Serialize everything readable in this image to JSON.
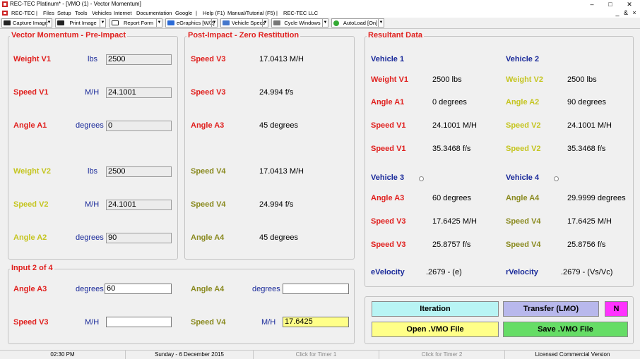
{
  "window": {
    "title": "REC-TEC Platinum* - [VMO (1) - Vector Momentum]",
    "minimize": "–",
    "maximize": "□",
    "close": "✕",
    "child_minimize": "_",
    "child_restore": "&",
    "child_close": "×"
  },
  "menu": {
    "app": "REC-TEC",
    "items": [
      "Files",
      "Setup",
      "Tools",
      "Vehicles",
      "Internet",
      "Documentation",
      "Google"
    ],
    "help": "Help (F1)",
    "manual": "Manual/Tutorial (F5)",
    "company": "REC-TEC LLC"
  },
  "toolbar": {
    "capture": "Capture Image",
    "print": "Print Image",
    "report": "Report Form",
    "egraphics": "eGraphics [W/2]",
    "vehicle_specs": "Vehicle Specs",
    "cycle": "Cycle Windows",
    "autoload": "AutoLoad [On]"
  },
  "pre": {
    "title": "Vector Momentum - Pre-Impact",
    "weight_v1": {
      "label": "Weight V1",
      "unit": "lbs",
      "value": "2500"
    },
    "speed_v1": {
      "label": "Speed V1",
      "unit": "M/H",
      "value": "24.1001"
    },
    "angle_a1": {
      "label": "Angle A1",
      "unit": "degrees",
      "value": "0"
    },
    "weight_v2": {
      "label": "Weight V2",
      "unit": "lbs",
      "value": "2500"
    },
    "speed_v2": {
      "label": "Speed V2",
      "unit": "M/H",
      "value": "24.1001"
    },
    "angle_a2": {
      "label": "Angle A2",
      "unit": "degrees",
      "value": "90"
    }
  },
  "post": {
    "title": "Post-Impact - Zero Restitution",
    "r1": {
      "label": "Speed V3",
      "value": "17.0413  M/H"
    },
    "r2": {
      "label": "Speed V3",
      "value": "24.994  f/s"
    },
    "r3": {
      "label": "Angle A3",
      "value": "45  degrees"
    },
    "r4": {
      "label": "Speed V4",
      "value": "17.0413  M/H"
    },
    "r5": {
      "label": "Speed V4",
      "value": "24.994  f/s"
    },
    "r6": {
      "label": "Angle A4",
      "value": "45  degrees"
    }
  },
  "input": {
    "title": "Input 2 of 4",
    "angle_a3": {
      "label": "Angle A3",
      "unit": "degrees",
      "value": "60"
    },
    "angle_a4": {
      "label": "Angle A4",
      "unit": "degrees",
      "value": ""
    },
    "speed_v3": {
      "label": "Speed V3",
      "unit": "M/H",
      "value": ""
    },
    "speed_v4": {
      "label": "Speed V4",
      "unit": "M/H",
      "value": "17.6425"
    }
  },
  "result": {
    "title": "Resultant Data",
    "vehicle1": "Vehicle 1",
    "vehicle2": "Vehicle 2",
    "vehicle3": "Vehicle 3",
    "vehicle4": "Vehicle 4",
    "v1": [
      {
        "label": "Weight V1",
        "value": "2500  lbs"
      },
      {
        "label": "Angle A1",
        "value": "0  degrees"
      },
      {
        "label": "Speed V1",
        "value": "24.1001  M/H"
      },
      {
        "label": "Speed V1",
        "value": "35.3468  f/s"
      }
    ],
    "v2": [
      {
        "label": "Weight V2",
        "value": "2500  lbs"
      },
      {
        "label": "Angle A2",
        "value": "90  degrees"
      },
      {
        "label": "Speed V2",
        "value": "24.1001  M/H"
      },
      {
        "label": "Speed V2",
        "value": "35.3468  f/s"
      }
    ],
    "v3": [
      {
        "label": "Angle A3",
        "value": "60  degrees"
      },
      {
        "label": "Speed V3",
        "value": "17.6425  M/H"
      },
      {
        "label": "Speed V3",
        "value": "25.8757  f/s"
      }
    ],
    "v4": [
      {
        "label": "Angle A4",
        "value": "29.9999  degrees"
      },
      {
        "label": "Speed V4",
        "value": "17.6425  M/H"
      },
      {
        "label": "Speed V4",
        "value": "25.8756  f/s"
      }
    ],
    "evelocity_label": "eVelocity",
    "evelocity_value": ".2679  -  (e)",
    "rvelocity_label": "rVelocity",
    "rvelocity_value": ".2679  -  (Vs/Vc)"
  },
  "buttons": {
    "iteration": "Iteration",
    "transfer": "Transfer (LMO)",
    "n": "N",
    "open": "Open .VMO File",
    "save": "Save .VMO File"
  },
  "status": {
    "time": "02:30 PM",
    "date": "Sunday  -  6 December 2015",
    "timer1": "Click for Timer 1",
    "timer2": "Click for Timer 2",
    "license": "Licensed Commercial Version"
  },
  "colors": {
    "red": "#e0201e",
    "yellow": "#c5c520",
    "navy": "#1a2a9a",
    "iteration_bg": "#b8f4f4",
    "transfer_bg": "#b8b8ec",
    "n_bg": "#ff33ff",
    "open_bg": "#ffff88",
    "save_bg": "#66dd66"
  }
}
